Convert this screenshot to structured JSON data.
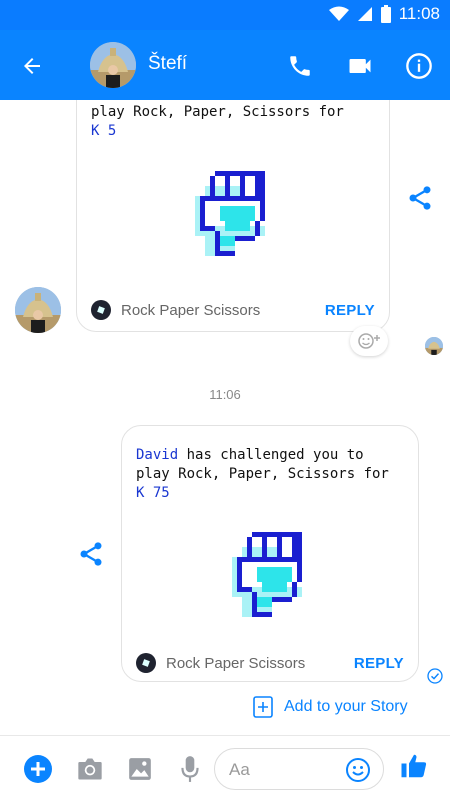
{
  "status_bar": {
    "time": "11:08"
  },
  "header": {
    "contact_name": "Štefí",
    "accent_color": "#0a84ff",
    "icons": [
      "back-arrow-icon",
      "phone-icon",
      "video-camera-icon",
      "info-icon"
    ]
  },
  "messages": [
    {
      "line_partial": "play Rock, Paper, Scissors for",
      "stake_prefix": "K",
      "stake": "5",
      "game_name": "Rock Paper Scissors",
      "reply_label": "REPLY"
    },
    {
      "timestamp": "11:06",
      "challenger": "David",
      "text": " has challenged you to",
      "line2": "play Rock, Paper, Scissors for",
      "stake_prefix": "K",
      "stake": "75",
      "game_name": "Rock Paper Scissors",
      "reply_label": "REPLY"
    }
  ],
  "story": {
    "label": "Add to your Story"
  },
  "composer": {
    "placeholder": "Aa",
    "icons": [
      "plus-icon",
      "camera-icon",
      "image-icon",
      "microphone-icon",
      "emoji-icon",
      "thumbs-up-icon"
    ]
  }
}
